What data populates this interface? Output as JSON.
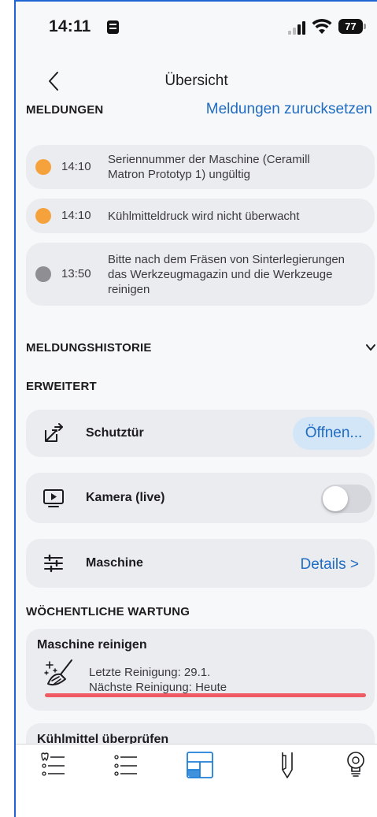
{
  "status_bar": {
    "time": "14:11",
    "battery": "77"
  },
  "nav": {
    "title": "Übersicht"
  },
  "messages_section": {
    "label": "MELDUNGEN",
    "reset_label": "Meldungen zurucksetzen",
    "items": [
      {
        "time": "14:10",
        "line1": "Seriennummer der Maschine (Ceramill",
        "line2": "Matron Prototyp 1) ungültig",
        "line3": "",
        "status_color": "#f6a23c"
      },
      {
        "time": "14:10",
        "line1": "Kühlmitteldruck wird nicht überwacht",
        "line2": "",
        "line3": "",
        "status_color": "#f6a23c"
      },
      {
        "time": "13:50",
        "line1": "Bitte nach dem Fräsen von Sinterlegierungen",
        "line2": "das Werkzeugmagazin und die Werkzeuge",
        "line3": "reinigen",
        "status_color": "#8e8e93"
      }
    ]
  },
  "history_section": {
    "label": "MELDUNGSHISTORIE"
  },
  "advanced_section": {
    "label": "ERWEITERT",
    "door": {
      "label": "Schutztür",
      "button": "Öffnen..."
    },
    "camera": {
      "label": "Kamera (live)",
      "enabled": false
    },
    "machine": {
      "label": "Maschine",
      "link": "Details >"
    }
  },
  "maintenance_section": {
    "label": "WÖCHENTLICHE WARTUNG",
    "clean": {
      "title": "Maschine reinigen",
      "last": "Letzte Reinigung: 29.1.",
      "next": "Nächste Reinigung: Heute",
      "progress_color": "#ef5a63"
    },
    "coolant": {
      "title": "Kühlmittel überprüfen"
    }
  },
  "tabbar": {
    "tabs": [
      {
        "icon": "tooth-list-icon",
        "active": false
      },
      {
        "icon": "list-icon",
        "active": false
      },
      {
        "icon": "overview-icon",
        "active": true
      },
      {
        "icon": "tool-icon",
        "active": false
      },
      {
        "icon": "bulb-icon",
        "active": false
      }
    ],
    "accent": "#1f7fd6"
  }
}
